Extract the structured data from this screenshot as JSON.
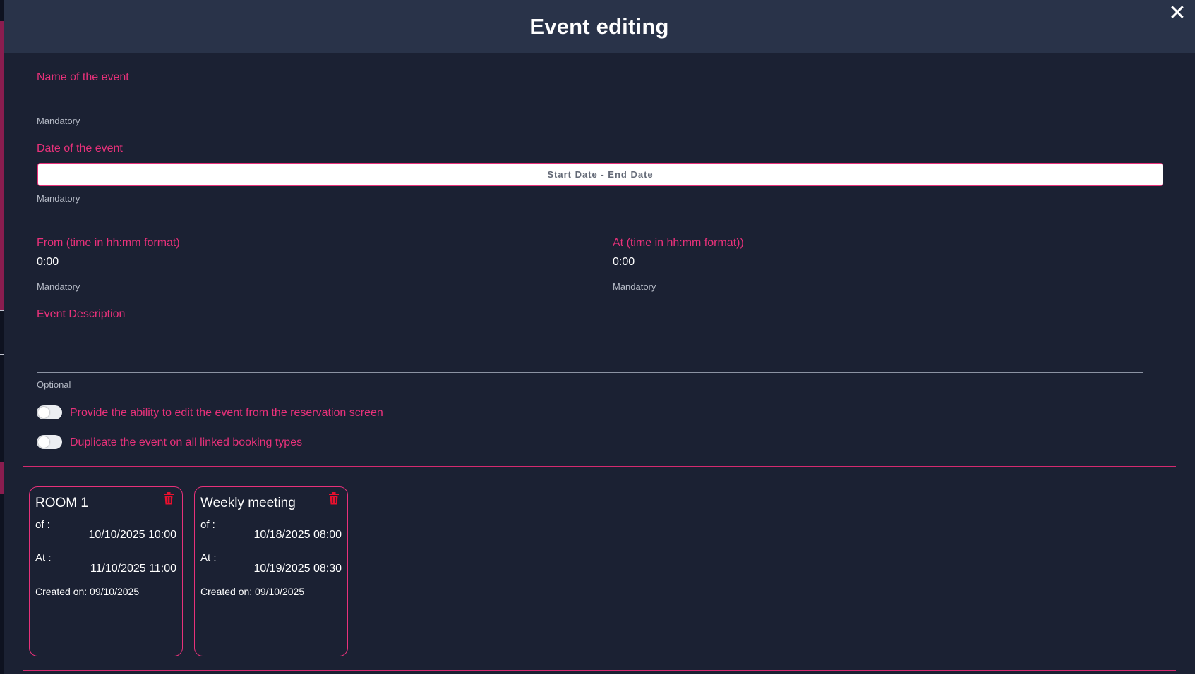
{
  "header": {
    "title": "Event editing",
    "close_icon": "✕"
  },
  "form": {
    "name": {
      "label": "Name of the event",
      "value": "",
      "hint": "Mandatory"
    },
    "date": {
      "label": "Date of the event",
      "placeholder": "Start Date - End Date",
      "hint": "Mandatory"
    },
    "from_time": {
      "label": "From (time in hh:mm format)",
      "value": "0:00",
      "hint": "Mandatory"
    },
    "at_time": {
      "label": "At (time in hh:mm format))",
      "value": "0:00",
      "hint": "Mandatory"
    },
    "description": {
      "label": "Event Description",
      "value": "",
      "hint": "Optional"
    },
    "toggles": [
      {
        "label": "Provide the ability to edit the event from the reservation screen",
        "on": false
      },
      {
        "label": "Duplicate the event on all linked booking types",
        "on": false
      }
    ]
  },
  "cards": [
    {
      "title": "ROOM 1",
      "of_label": "of :",
      "of_value": "10/10/2025 10:00",
      "at_label": "At :",
      "at_value": "11/10/2025 11:00",
      "created": "Created on: 09/10/2025"
    },
    {
      "title": "Weekly meeting",
      "of_label": "of :",
      "of_value": "10/18/2025 08:00",
      "at_label": "At :",
      "at_value": "10/19/2025 08:30",
      "created": "Created on: 09/10/2025"
    }
  ],
  "colors": {
    "accent": "#e8317a",
    "background": "#1b2133",
    "header": "#293349",
    "danger": "#e8102e"
  },
  "icons": {
    "close": "close-icon",
    "delete": "trash-icon"
  }
}
